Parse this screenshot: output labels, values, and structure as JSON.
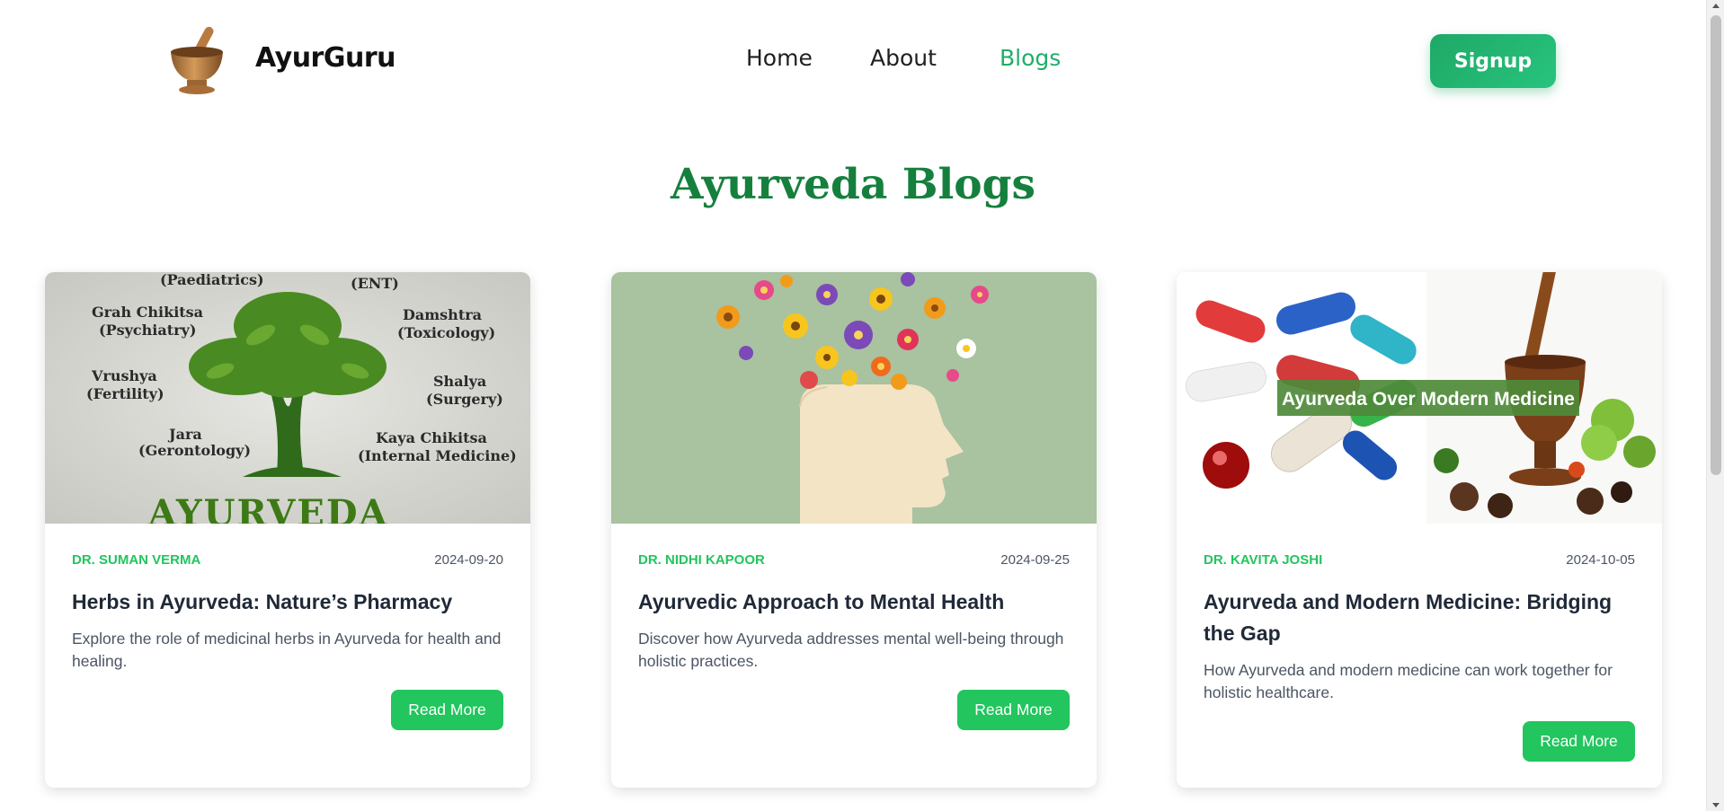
{
  "header": {
    "brand": "AyurGuru",
    "nav": [
      {
        "label": "Home",
        "active": false
      },
      {
        "label": "About",
        "active": false
      },
      {
        "label": "Blogs",
        "active": true
      }
    ],
    "signup_label": "Signup"
  },
  "page_title": "Ayurveda Blogs",
  "blogs": [
    {
      "author": "Dr. Suman Verma",
      "date": "2024-09-20",
      "title": "Herbs in Ayurveda: Nature’s Pharmacy",
      "description": "Explore the role of medicinal herbs in Ayurveda for health and healing.",
      "button": "Read More",
      "image": {
        "labels": [
          "(Paediatrics)",
          "(ENT)",
          "Grah Chikitsa",
          "(Psychiatry)",
          "Damshtra",
          "(Toxicology)",
          "Vrushya",
          "(Fertility)",
          "Shalya",
          "(Surgery)",
          "Jara",
          "(Gerontology)",
          "Kaya Chikitsa",
          "(Internal Medicine)",
          "AYURVEDA"
        ]
      }
    },
    {
      "author": "Dr. Nidhi Kapoor",
      "date": "2024-09-25",
      "title": "Ayurvedic Approach to Mental Health",
      "description": "Discover how Ayurveda addresses mental well-being through holistic practices.",
      "button": "Read More"
    },
    {
      "author": "Dr. Kavita Joshi",
      "date": "2024-10-05",
      "title": "Ayurveda and Modern Medicine: Bridging the Gap",
      "description": "How Ayurveda and modern medicine can work together for holistic healthcare.",
      "button": "Read More",
      "image": {
        "overlay_text": "Ayurveda Over Modern Medicine"
      }
    }
  ],
  "colors": {
    "accent": "#22c55e",
    "title_green": "#15803d",
    "nav_active": "#1fae6a"
  }
}
